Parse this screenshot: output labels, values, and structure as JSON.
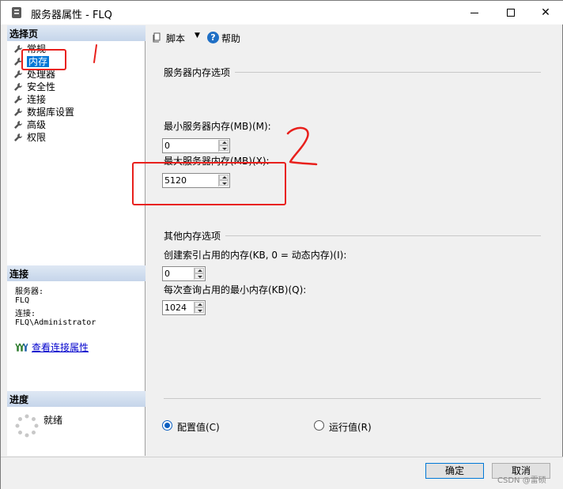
{
  "window": {
    "title": "服务器属性 - FLQ",
    "minimize": "—",
    "maximize": "☐",
    "close": "✕"
  },
  "left": {
    "select_page_header": "选择页",
    "nav_items": [
      {
        "label": "常规"
      },
      {
        "label": "内存"
      },
      {
        "label": "处理器"
      },
      {
        "label": "安全性"
      },
      {
        "label": "连接"
      },
      {
        "label": "数据库设置"
      },
      {
        "label": "高级"
      },
      {
        "label": "权限"
      }
    ],
    "connection_header": "连接",
    "server_label": "服务器:",
    "server_value": "FLQ",
    "connection_label": "连接:",
    "connection_value": "FLQ\\Administrator",
    "view_connection_link": "查看连接属性",
    "progress_header": "进度",
    "progress_status": "就绪"
  },
  "toolbar": {
    "script_label": "脚本",
    "dropdown_glyph": "▼",
    "help_label": "帮助",
    "help_glyph": "?"
  },
  "memory": {
    "server_memory_group": "服务器内存选项",
    "min_label": "最小服务器内存(MB)(M):",
    "min_value": "0",
    "max_label": "最大服务器内存(MB)(X):",
    "max_value": "5120",
    "other_group": "其他内存选项",
    "index_label": "创建索引占用的内存(KB, 0 = 动态内存)(I):",
    "index_value": "0",
    "query_label": "每次查询占用的最小内存(KB)(Q):",
    "query_value": "1024"
  },
  "view_options": {
    "configured": "配置值(C)",
    "running": "运行值(R)",
    "selected": "configured"
  },
  "buttons": {
    "ok": "确定",
    "cancel": "取消"
  },
  "watermark": "CSDN @雷硕",
  "annotation": {
    "mark_1": "1",
    "mark_2": "2",
    "color": "#e8201c"
  }
}
